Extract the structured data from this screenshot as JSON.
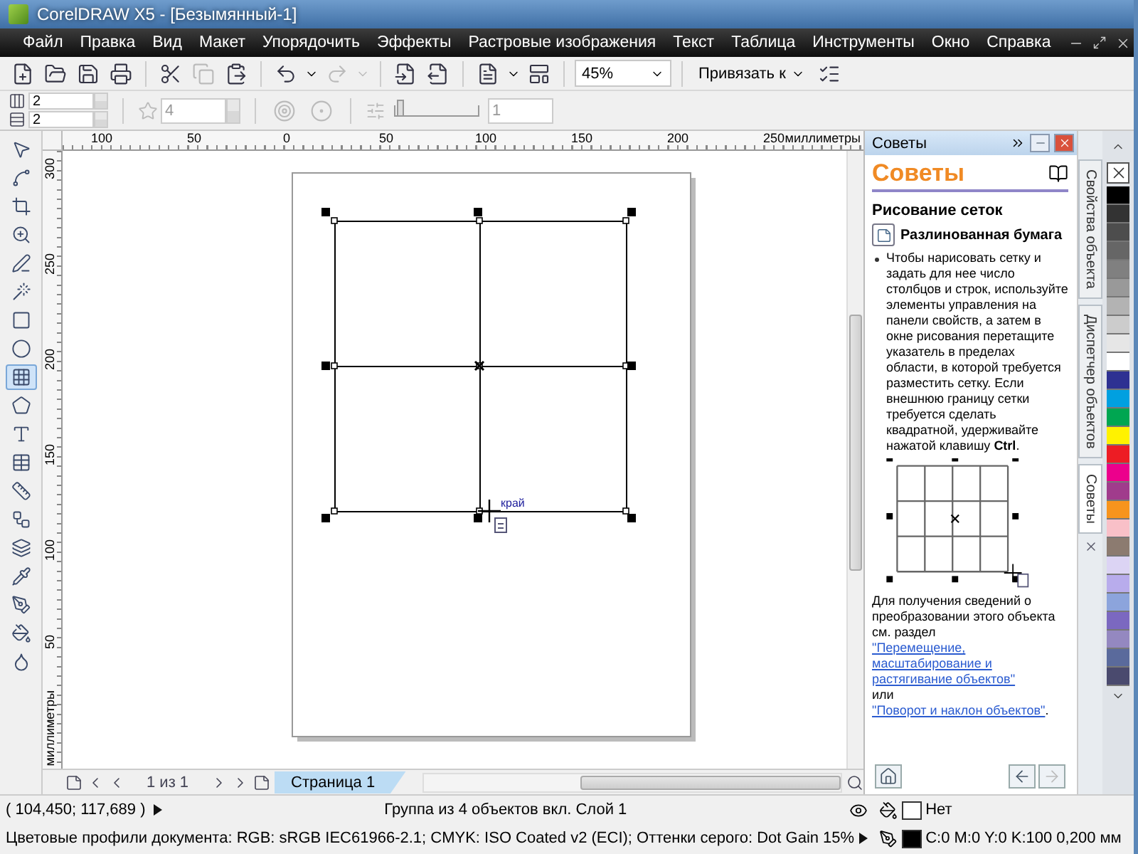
{
  "window": {
    "title": "CorelDRAW X5 - [Безымянный-1]"
  },
  "menu": [
    "Файл",
    "Правка",
    "Вид",
    "Макет",
    "Упорядочить",
    "Эффекты",
    "Растровые изображения",
    "Текст",
    "Таблица",
    "Инструменты",
    "Окно",
    "Справка"
  ],
  "toolbar": {
    "zoom": "45%",
    "snap": "Привязать к"
  },
  "property_bar": {
    "columns": "2",
    "rows": "2",
    "sides": "4",
    "expansion": {
      "level": 0.05
    },
    "sharpness": "1"
  },
  "rulers": {
    "horizontal": [
      "100",
      "50",
      "0",
      "50",
      "100",
      "150",
      "200",
      "250"
    ],
    "horizontal_unit": "миллиметры",
    "vertical": [
      "300",
      "250",
      "200",
      "150",
      "100",
      "50"
    ],
    "vertical_unit": "миллиметры"
  },
  "toolbox": [
    {
      "kind": "pick",
      "selected": false
    },
    {
      "kind": "shape",
      "selected": false
    },
    {
      "kind": "crop",
      "selected": false
    },
    {
      "kind": "zoom",
      "selected": false
    },
    {
      "kind": "freehand",
      "selected": false
    },
    {
      "kind": "smart",
      "selected": false
    },
    {
      "kind": "rectangle",
      "selected": false
    },
    {
      "kind": "ellipse",
      "selected": false
    },
    {
      "kind": "graph",
      "selected": true
    },
    {
      "kind": "polygon",
      "selected": false
    },
    {
      "kind": "text",
      "selected": false
    },
    {
      "kind": "table",
      "selected": false
    },
    {
      "kind": "dimension",
      "selected": false
    },
    {
      "kind": "connector",
      "selected": false
    },
    {
      "kind": "blend",
      "selected": false
    },
    {
      "kind": "eyedropper",
      "selected": false
    },
    {
      "kind": "outline",
      "selected": false
    },
    {
      "kind": "fill",
      "selected": false
    },
    {
      "kind": "interactive",
      "selected": false
    }
  ],
  "canvas": {
    "cursor_label": "край"
  },
  "docker": {
    "header": "Советы",
    "title": "Советы",
    "heading": "Рисование сеток",
    "tool": "Разлинованная бумага",
    "bullet": "Чтобы нарисовать сетку и задать для нее число столбцов и строк, используйте элементы управления на панели свойств, а затем в окне рисования перетащите указатель в пределах области, в которой требуется разместить сетку. Если внешнюю границу сетки требуется сделать квадратной, удерживайте нажатой клавишу **Ctrl**.",
    "info": "Для получения сведений о преобразовании этого объекта см. раздел",
    "link1": "\"Перемещение, масштабирование и растягивание объектов\"",
    "joiner": "или",
    "link2": "\"Поворот и наклон объектов\"",
    "end": "."
  },
  "side_tabs": [
    {
      "label": "Свойства объекта",
      "selected": false
    },
    {
      "label": "Диспетчер объектов",
      "selected": false
    },
    {
      "label": "Советы",
      "selected": true
    }
  ],
  "palette": [
    {
      "color": "#000000"
    },
    {
      "color": "#333333"
    },
    {
      "color": "#4d4d4d"
    },
    {
      "color": "#666666"
    },
    {
      "color": "#808080"
    },
    {
      "color": "#999999"
    },
    {
      "color": "#b3b3b3"
    },
    {
      "color": "#cccccc"
    },
    {
      "color": "#e6e6e6"
    },
    {
      "color": "#ffffff"
    },
    {
      "color": "#2e3192"
    },
    {
      "color": "#00a0e0"
    },
    {
      "color": "#00a651"
    },
    {
      "color": "#fff200"
    },
    {
      "color": "#ed1c24"
    },
    {
      "color": "#ec008c"
    },
    {
      "color": "#a03c8c"
    },
    {
      "color": "#f7941d"
    },
    {
      "color": "#f9c0c8"
    },
    {
      "color": "#8c7b70"
    },
    {
      "color": "#dcd4f4"
    },
    {
      "color": "#b8acec"
    },
    {
      "color": "#8ca4dc"
    },
    {
      "color": "#7b68c0"
    },
    {
      "color": "#9488c0"
    },
    {
      "color": "#5a6a9c"
    },
    {
      "color": "#4a4a6e"
    }
  ],
  "page_nav": {
    "counter": "1 из 1",
    "tabs": [
      {
        "label": "Страница 1",
        "selected": true
      }
    ]
  },
  "status": {
    "coords": "( 104,450; 117,689 )",
    "selection": "Группа из 4 объектов вкл. Слой 1",
    "fill": "Нет",
    "outline": "C:0 M:0 Y:0 K:100",
    "outline_width": "0,200 мм",
    "profiles": "Цветовые профили документа: RGB: sRGB IEC61966-2.1; CMYK: ISO Coated v2 (ECI); Оттенки серого: Dot Gain 15%"
  }
}
